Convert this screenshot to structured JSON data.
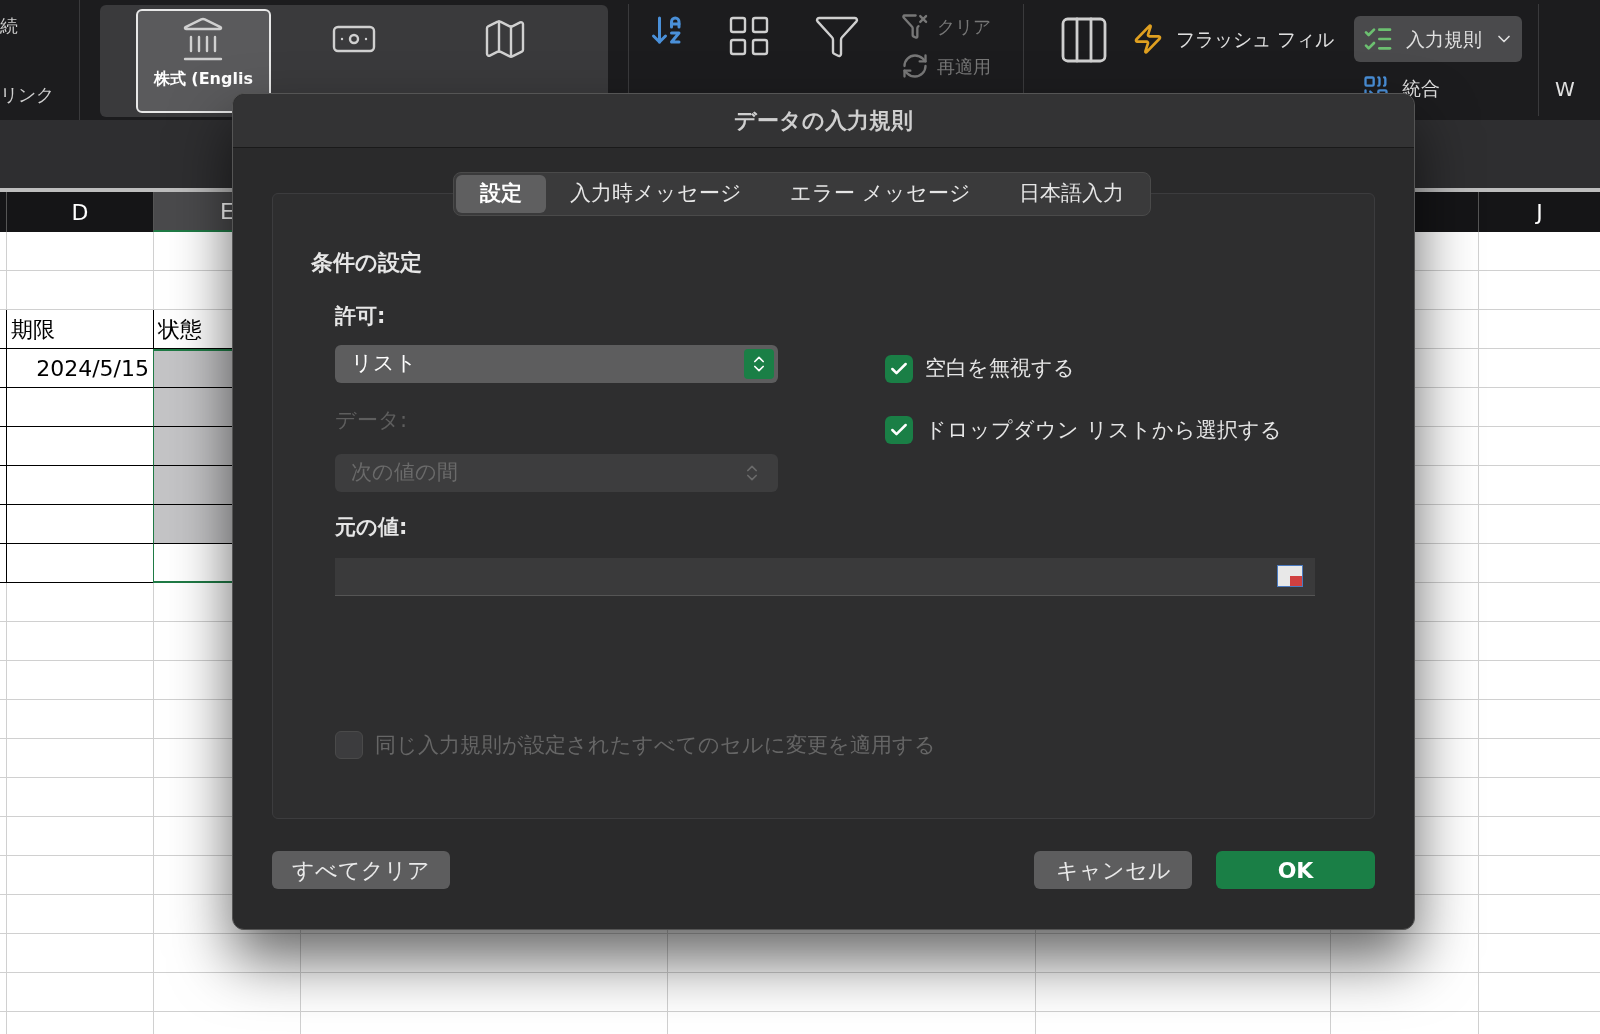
{
  "ribbon": {
    "left_labels": [
      "続",
      "リンク"
    ],
    "data_types": [
      {
        "kind": "stocks",
        "selected": true,
        "label": "株式 (Englis"
      },
      {
        "kind": "currency",
        "selected": false
      },
      {
        "kind": "geography",
        "selected": false
      }
    ],
    "filter_actions": [
      {
        "kind": "clear",
        "label": "クリア",
        "disabled": true
      },
      {
        "kind": "reapply",
        "label": "再適用",
        "disabled": true
      }
    ],
    "flash_fill": "フラッシュ フィル",
    "validation": {
      "label": "入力規則",
      "active": true
    },
    "consolidate": "統合",
    "edge_label": "W"
  },
  "sheet": {
    "columns": [
      {
        "label": "D",
        "selected": false
      },
      {
        "label": "E",
        "selected": true
      },
      {
        "label": "J",
        "selected": false
      }
    ],
    "rows": [
      {
        "kind": "header",
        "col_d": "期限",
        "col_e": "状態"
      },
      {
        "kind": "data",
        "col_d": "2024/5/15",
        "e_filled": true
      },
      {
        "kind": "data",
        "e_filled": true
      },
      {
        "kind": "data",
        "e_filled": true
      },
      {
        "kind": "data",
        "e_filled": true
      },
      {
        "kind": "data",
        "e_filled": true
      },
      {
        "kind": "data",
        "e_filled": false
      }
    ]
  },
  "dialog": {
    "title": "データの入力規則",
    "tabs": [
      {
        "label": "設定",
        "selected": true
      },
      {
        "label": "入力時メッセージ",
        "selected": false
      },
      {
        "label": "エラー メッセージ",
        "selected": false
      },
      {
        "label": "日本語入力",
        "selected": false
      }
    ],
    "section_title": "条件の設定",
    "allow_label": "許可:",
    "allow_value": "リスト",
    "data_label": {
      "text": "データ:",
      "disabled": true
    },
    "data_value": {
      "value": "次の値の間",
      "disabled": true
    },
    "source_label": "元の値:",
    "checkboxes": [
      {
        "label": "空白を無視する",
        "checked": true
      },
      {
        "label": "ドロップダウン リストから選択する",
        "checked": true
      }
    ],
    "apply_all": {
      "label": "同じ入力規則が設定されたすべてのセルに変更を適用する",
      "checked": false,
      "disabled": true
    },
    "buttons": [
      {
        "label": "すべてクリア",
        "kind": "secondary"
      },
      {
        "label": "キャンセル",
        "kind": "secondary"
      },
      {
        "label": "OK",
        "kind": "primary"
      }
    ]
  }
}
